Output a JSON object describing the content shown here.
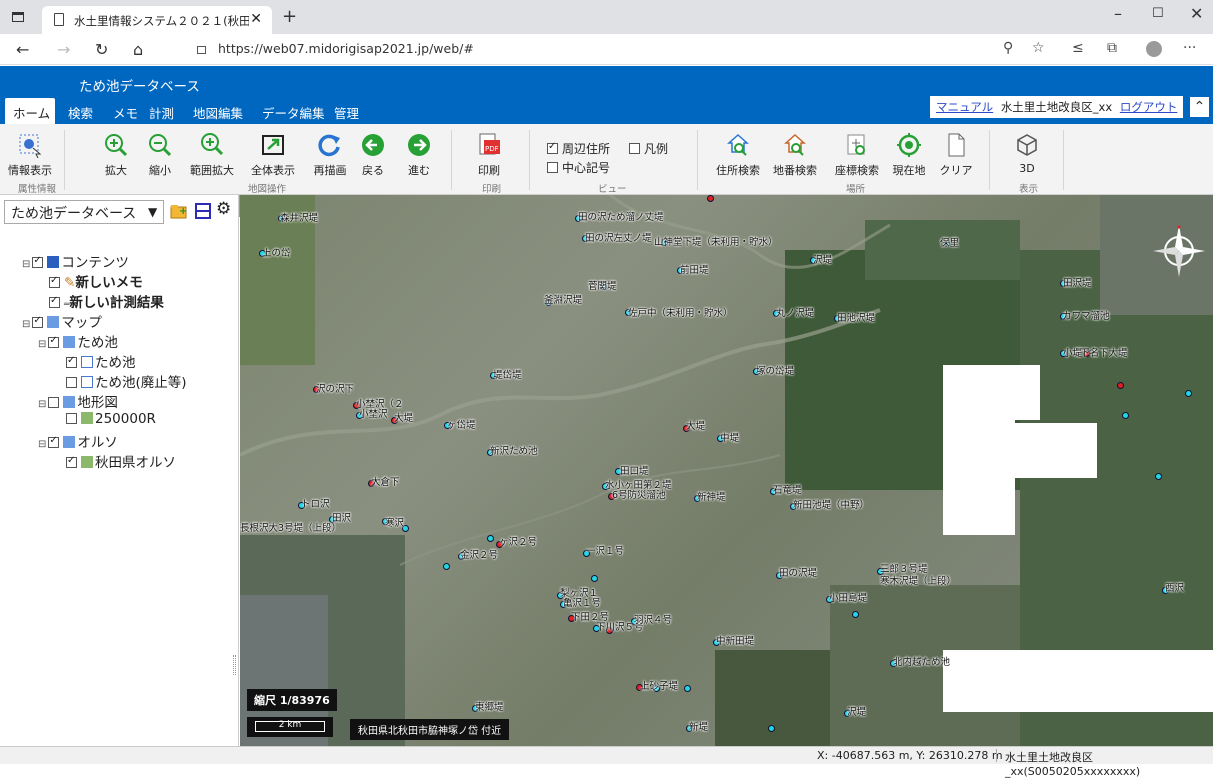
{
  "browser": {
    "tab_title": "水土里情報システム２０２１(秋田",
    "url": "https://web07.midorigisap2021.jp/web/#"
  },
  "app": {
    "title": "ため池データベース",
    "menu": [
      "ホーム",
      "検索",
      "メモ",
      "計測",
      "地図編集",
      "データ編集",
      "管理"
    ],
    "manual_link": "マニュアル",
    "user": "水土里土地改良区_xx",
    "logout_link": "ログアウト"
  },
  "ribbon": {
    "info_btn": "情報表示",
    "group_attr": "属性情報",
    "zoom_in": "拡大",
    "zoom_out": "縮小",
    "range_zoom": "範囲拡大",
    "full_view": "全体表示",
    "redraw": "再描画",
    "back": "戻る",
    "forward": "進む",
    "group_map": "地図操作",
    "print": "印刷",
    "group_print": "印刷",
    "nearby_address": "周辺住所",
    "legend": "凡例",
    "center_mark": "中心記号",
    "group_view": "ビュー",
    "address_search": "住所検索",
    "lot_search": "地番検索",
    "coord_search": "座標検索",
    "current_location": "現在地",
    "clear": "クリア",
    "group_place": "場所",
    "three_d": "3D",
    "group_display": "表示",
    "colors": {
      "accent": "#0067c0",
      "green": "#27a035",
      "blue": "#2a74d1"
    }
  },
  "panel": {
    "db_select": "ため池データベース",
    "tree": {
      "contents": "コンテンツ",
      "new_memo": "新しいメモ",
      "new_measure": "新しい計測結果",
      "map": "マップ",
      "tameike": "ため池",
      "tameike_layer": "ため池",
      "tameike_abolished": "ため池(廃止等)",
      "topo": "地形図",
      "topo_layer": "250000R",
      "ortho": "オルソ",
      "ortho_layer": "秋田県オルソ"
    }
  },
  "map": {
    "scale": "縮尺 1/83976",
    "scale_bar": "2 km",
    "location": "秋田県北秋田市脇神塚ノ岱 付近",
    "labels": [
      "田の沢ため溜ノ丈堤",
      "田の沢左丈ノ堤",
      "山神堂下堤（未利用・貯水）",
      "前田堤",
      "上の岱",
      "森井沢堤",
      "菅関堤",
      "釜淵沢堤",
      "佐戸中（未利用・貯水）",
      "沢堤",
      "田沢堤",
      "丸ノ沢堤",
      "田池沢堤",
      "カワマ溜池",
      "保里",
      "堤岱堤",
      "塚の岱堤",
      "小堤",
      "下名下大堤",
      "沢の沢下",
      "小埜沢（２",
      "小埜沢",
      "大堤",
      "ヶ岱堤",
      "大堤",
      "中堤",
      "新沢ため池",
      "田口堤",
      "水小ヶ田第２堤",
      "6号防災溜池",
      "新神堤",
      "石竜堤",
      "新田池堤（中野）",
      "大倉下",
      "トロ沢",
      "田沢",
      "長根沢大3号堤（上段）",
      "寒沢",
      "ヶ沢２号",
      "金沢２号",
      "一沢１号",
      "田の沢堤",
      "三郎３号堤",
      "寒木沢堤（上段）",
      "西沢",
      "梨ヶ沢１",
      "亀沢１号",
      "下田２号",
      "下川沢５号",
      "羽沢４号",
      "小田島堤",
      "中新田堤",
      "北内越ため池",
      "上砂子堤",
      "東郷堤",
      "沢堤",
      "新堤"
    ]
  },
  "status": {
    "coords": "X: -40687.563 m, Y: 26310.278 m",
    "area": "水土里土地改良区_xx(S0050205xxxxxxxx)"
  }
}
